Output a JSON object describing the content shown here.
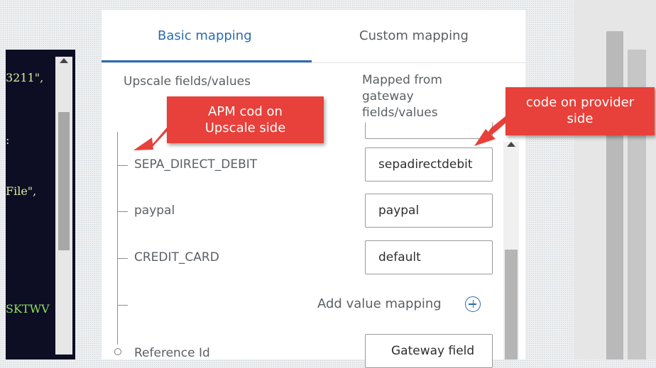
{
  "code_lines": [
    {
      "text": "3211\","
    },
    {
      "text": ":"
    },
    {
      "text": "File\","
    },
    {
      "text": "SKTWV"
    }
  ],
  "tabs": [
    {
      "label": "Basic mapping",
      "active": true
    },
    {
      "label": "Custom mapping",
      "active": false
    }
  ],
  "columns": {
    "left": "Upscale fields/values",
    "right_lines": [
      "Mapped from",
      "gateway",
      "fields/values"
    ]
  },
  "rows": [
    {
      "label": "SEPA_DIRECT_DEBIT",
      "value": "sepadirectdebit"
    },
    {
      "label": "paypal",
      "value": "paypal"
    },
    {
      "label": "CREDIT_CARD",
      "value": "default"
    }
  ],
  "add_value_mapping": "Add value mapping",
  "reference": {
    "label": "Reference Id",
    "value": "Gateway field"
  },
  "callouts": {
    "apm": [
      "APM cod on",
      "Upscale side"
    ],
    "provider": [
      "code on provider",
      "side"
    ]
  },
  "colors": {
    "accent": "#2b6cb0",
    "callout": "#e8403a"
  }
}
